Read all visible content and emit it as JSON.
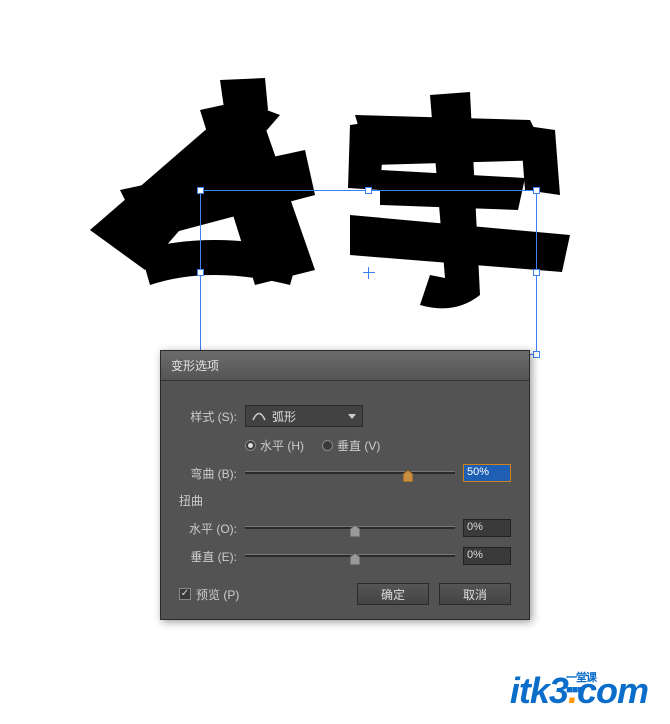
{
  "dialog": {
    "title": "变形选项",
    "styleLabel": "样式 (S):",
    "styleValue": "弧形",
    "radios": {
      "horizontal": "水平 (H)",
      "vertical": "垂直 (V)",
      "selected": "horizontal"
    },
    "bend": {
      "label": "弯曲 (B):",
      "value": "50%",
      "pos": 75
    },
    "distortLabel": "扭曲",
    "hDistort": {
      "label": "水平 (O):",
      "value": "0%",
      "pos": 50
    },
    "vDistort": {
      "label": "垂直 (E):",
      "value": "0%",
      "pos": 50
    },
    "preview": {
      "label": "预览 (P)",
      "checked": true
    },
    "ok": "确定",
    "cancel": "取消"
  },
  "watermark": {
    "brand": "itk3",
    "dot": ".",
    "com": "com",
    "tag1": "一堂课",
    "tag2": "■■■"
  },
  "sampleText": "文字"
}
